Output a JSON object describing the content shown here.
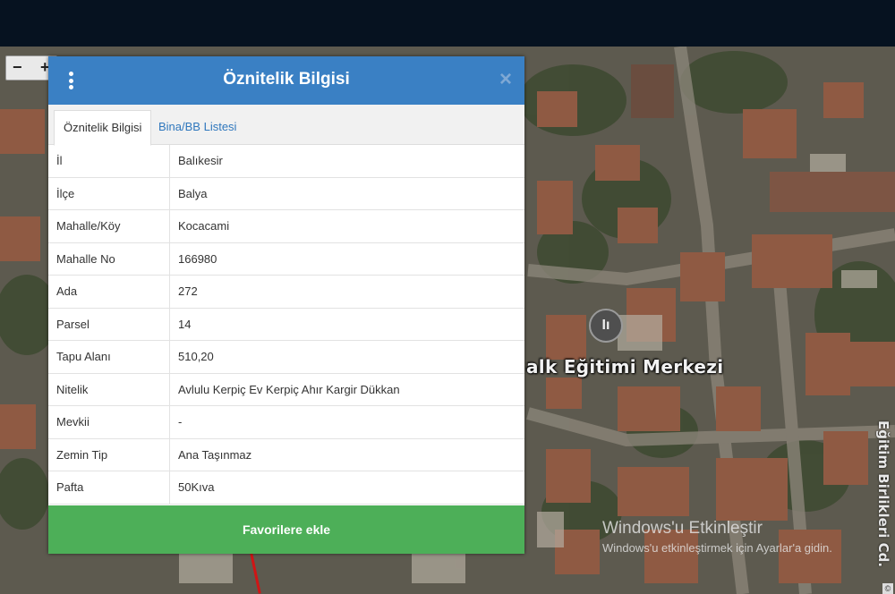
{
  "panel": {
    "title": "Öznitelik Bilgisi",
    "tabs": [
      {
        "label": "Öznitelik Bilgisi",
        "active": true
      },
      {
        "label": "Bina/BB Listesi",
        "active": false
      }
    ],
    "rows": [
      {
        "key": "İl",
        "value": "Balıkesir"
      },
      {
        "key": "İlçe",
        "value": "Balya"
      },
      {
        "key": "Mahalle/Köy",
        "value": "Kocacami"
      },
      {
        "key": "Mahalle No",
        "value": "166980"
      },
      {
        "key": "Ada",
        "value": "272"
      },
      {
        "key": "Parsel",
        "value": "14"
      },
      {
        "key": "Tapu Alanı",
        "value": "510,20"
      },
      {
        "key": "Nitelik",
        "value": "Avlulu Kerpiç Ev Kerpiç Ahır Kargir Dükkan"
      },
      {
        "key": "Mevkii",
        "value": "-"
      },
      {
        "key": "Zemin Tip",
        "value": "Ana Taşınmaz"
      },
      {
        "key": "Pafta",
        "value": "50Kıva"
      }
    ],
    "favorite_button": "Favorilere ekle"
  },
  "map": {
    "place_label": "alk Eğitimi Merkezi",
    "vertical_label": "Eğitim Birlikleri Cd.",
    "zoom_out": "−",
    "zoom_in": "+",
    "pin_glyph": "Iı"
  },
  "watermark": {
    "title": "Windows'u Etkinleştir",
    "subtitle": "Windows'u etkinleştirmek için Ayarlar'a gidin."
  },
  "colors": {
    "header": "#3a80c4",
    "button": "#4daf58",
    "tab_link": "#2f77bd"
  }
}
